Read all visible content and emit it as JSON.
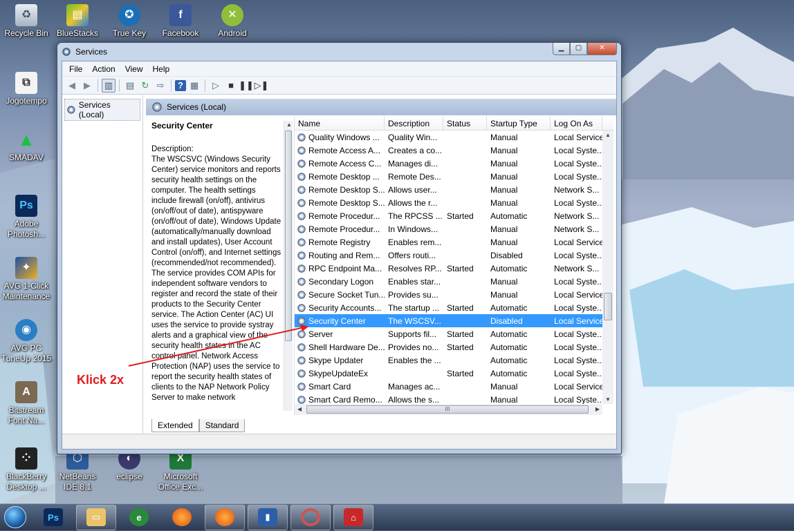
{
  "desktop_icons": [
    {
      "label": "Recycle Bin",
      "icon": "recycle-bin-icon"
    },
    {
      "label": "BlueStacks",
      "icon": "bluestacks-icon"
    },
    {
      "label": "True Key",
      "icon": "true-key-icon"
    },
    {
      "label": "Facebook",
      "icon": "facebook-icon"
    },
    {
      "label": "Android",
      "icon": "android-icon"
    },
    {
      "label": "Jogotempo",
      "icon": "shortcut-icon"
    },
    {
      "label": "SMADAV",
      "icon": "smadav-icon"
    },
    {
      "label": "Adobe Photosh...",
      "icon": "photoshop-icon"
    },
    {
      "label": "AVG 1-Click Maintenance",
      "icon": "avg-icon"
    },
    {
      "label": "AVG PC TuneUp 2015",
      "icon": "avg-tuneup-icon"
    },
    {
      "label": "Bitstream Font Na...",
      "icon": "font-icon"
    },
    {
      "label": "BlackBerry Desktop ...",
      "icon": "blackberry-icon"
    },
    {
      "label": "NetBeans IDE 8.1",
      "icon": "netbeans-icon"
    },
    {
      "label": "eclipse",
      "icon": "eclipse-icon"
    },
    {
      "label": "Microsoft Office Exc...",
      "icon": "excel-icon"
    }
  ],
  "window": {
    "title": "Services",
    "menu": [
      "File",
      "Action",
      "View",
      "Help"
    ],
    "tree_root": "Services (Local)",
    "header": "Services (Local)",
    "description": {
      "title": "Security Center",
      "text": "Description:\nThe WSCSVC (Windows Security Center) service monitors and reports security health settings on the computer.  The health settings include firewall (on/off), antivirus (on/off/out of date), antispyware (on/off/out of date), Windows Update (automatically/manually download and install updates), User Account Control (on/off), and Internet settings (recommended/not recommended). The service provides COM APIs for independent software vendors to register and record the state of their products to the Security Center service.  The Action Center (AC) UI uses the service to provide systray alerts and a graphical view of the security health states in the AC control panel.  Network Access Protection (NAP) uses the service to report the security health states of clients to the NAP Network Policy Server to make network"
    },
    "columns": [
      "Name",
      "Description",
      "Status",
      "Startup Type",
      "Log On As"
    ],
    "rows": [
      {
        "name": "Quality Windows ...",
        "desc": "Quality Win...",
        "status": "",
        "startup": "Manual",
        "logon": "Local Service"
      },
      {
        "name": "Remote Access A...",
        "desc": "Creates a co...",
        "status": "",
        "startup": "Manual",
        "logon": "Local Syste..."
      },
      {
        "name": "Remote Access C...",
        "desc": "Manages di...",
        "status": "",
        "startup": "Manual",
        "logon": "Local Syste..."
      },
      {
        "name": "Remote Desktop ...",
        "desc": "Remote Des...",
        "status": "",
        "startup": "Manual",
        "logon": "Local Syste..."
      },
      {
        "name": "Remote Desktop S...",
        "desc": "Allows user...",
        "status": "",
        "startup": "Manual",
        "logon": "Network S..."
      },
      {
        "name": "Remote Desktop S...",
        "desc": "Allows the r...",
        "status": "",
        "startup": "Manual",
        "logon": "Local Syste..."
      },
      {
        "name": "Remote Procedur...",
        "desc": "The RPCSS ...",
        "status": "Started",
        "startup": "Automatic",
        "logon": "Network S..."
      },
      {
        "name": "Remote Procedur...",
        "desc": "In Windows...",
        "status": "",
        "startup": "Manual",
        "logon": "Network S..."
      },
      {
        "name": "Remote Registry",
        "desc": "Enables rem...",
        "status": "",
        "startup": "Manual",
        "logon": "Local Service"
      },
      {
        "name": "Routing and Rem...",
        "desc": "Offers routi...",
        "status": "",
        "startup": "Disabled",
        "logon": "Local Syste..."
      },
      {
        "name": "RPC Endpoint Ma...",
        "desc": "Resolves RP...",
        "status": "Started",
        "startup": "Automatic",
        "logon": "Network S..."
      },
      {
        "name": "Secondary Logon",
        "desc": "Enables star...",
        "status": "",
        "startup": "Manual",
        "logon": "Local Syste..."
      },
      {
        "name": "Secure Socket Tun...",
        "desc": "Provides su...",
        "status": "",
        "startup": "Manual",
        "logon": "Local Service"
      },
      {
        "name": "Security Accounts...",
        "desc": "The startup ...",
        "status": "Started",
        "startup": "Automatic",
        "logon": "Local Syste..."
      },
      {
        "name": "Security Center",
        "desc": "The WSCSV...",
        "status": "",
        "startup": "Disabled",
        "logon": "Local Service",
        "selected": true
      },
      {
        "name": "Server",
        "desc": "Supports fil...",
        "status": "Started",
        "startup": "Automatic",
        "logon": "Local Syste..."
      },
      {
        "name": "Shell Hardware De...",
        "desc": "Provides no...",
        "status": "Started",
        "startup": "Automatic",
        "logon": "Local Syste..."
      },
      {
        "name": "Skype Updater",
        "desc": "Enables the ...",
        "status": "",
        "startup": "Automatic",
        "logon": "Local Syste..."
      },
      {
        "name": "SkypeUpdateEx",
        "desc": "",
        "status": "Started",
        "startup": "Automatic",
        "logon": "Local Syste..."
      },
      {
        "name": "Smart Card",
        "desc": "Manages ac...",
        "status": "",
        "startup": "Manual",
        "logon": "Local Service"
      },
      {
        "name": "Smart Card Remo...",
        "desc": "Allows the s...",
        "status": "",
        "startup": "Manual",
        "logon": "Local Syste..."
      }
    ],
    "tabs": [
      "Extended",
      "Standard"
    ]
  },
  "annotation": "Klick 2x",
  "colors": {
    "selection": "#3399ff",
    "annotation": "#e21b1b"
  }
}
